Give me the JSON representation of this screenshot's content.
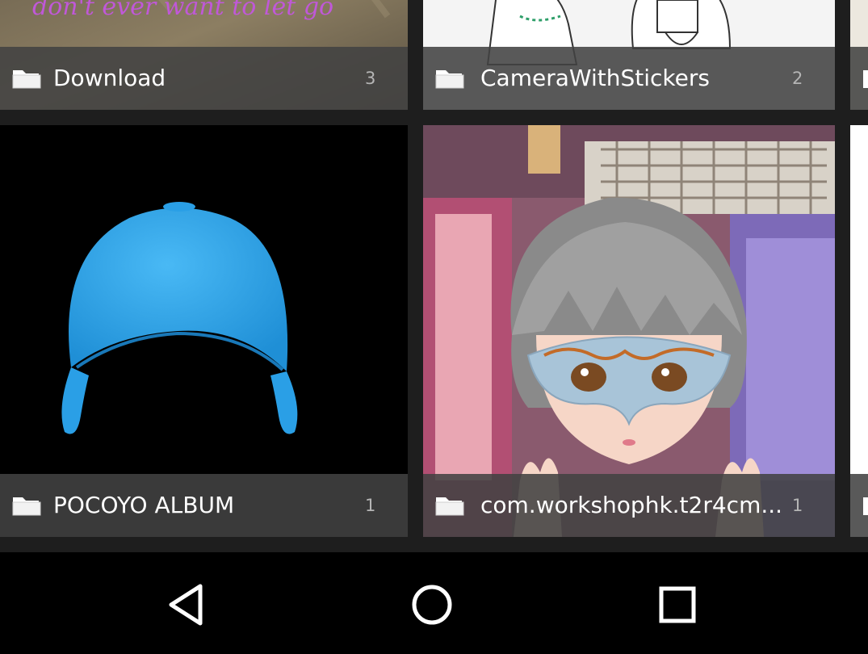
{
  "albums": [
    {
      "name": "Download",
      "count": "3",
      "thumb_text": "don't ever want to let go"
    },
    {
      "name": "CameraWithStickers",
      "count": "2"
    },
    {
      "name": "POCOYO ALBUM",
      "count": "1"
    },
    {
      "name": "com.workshophk.t2r4cm...",
      "count": "1"
    }
  ],
  "icons": {
    "folder": "folder-icon",
    "back": "back-triangle-icon",
    "home": "home-circle-icon",
    "recents": "recents-square-icon"
  },
  "colors": {
    "caption_bg": "#424242",
    "count_text": "#b5b5b5",
    "cap_blue": "#2fa7ec",
    "nav_bar": "#000000"
  }
}
